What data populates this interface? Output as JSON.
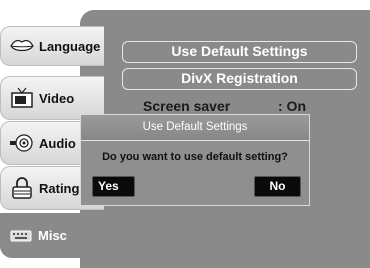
{
  "tabs": [
    {
      "label": "Language",
      "icon": "lips-icon"
    },
    {
      "label": "Video",
      "icon": "tv-icon"
    },
    {
      "label": "Audio",
      "icon": "speaker-icon"
    },
    {
      "label": "Rating",
      "icon": "lock-icon"
    },
    {
      "label": "Misc",
      "icon": "keyboard-icon",
      "active": true
    }
  ],
  "menu": {
    "use_default": "Use Default Settings",
    "divx_registration": "DivX Registration",
    "screen_saver_label": "Screen saver",
    "screen_saver_value": ": On"
  },
  "dialog": {
    "title": "Use Default Settings",
    "message": "Do you want to use default setting?",
    "yes_label": "Yes",
    "no_label": "No"
  },
  "colors": {
    "panel": "#8a8a8a",
    "button_dark": "#0a0a0a",
    "text_light": "#ffffff"
  }
}
